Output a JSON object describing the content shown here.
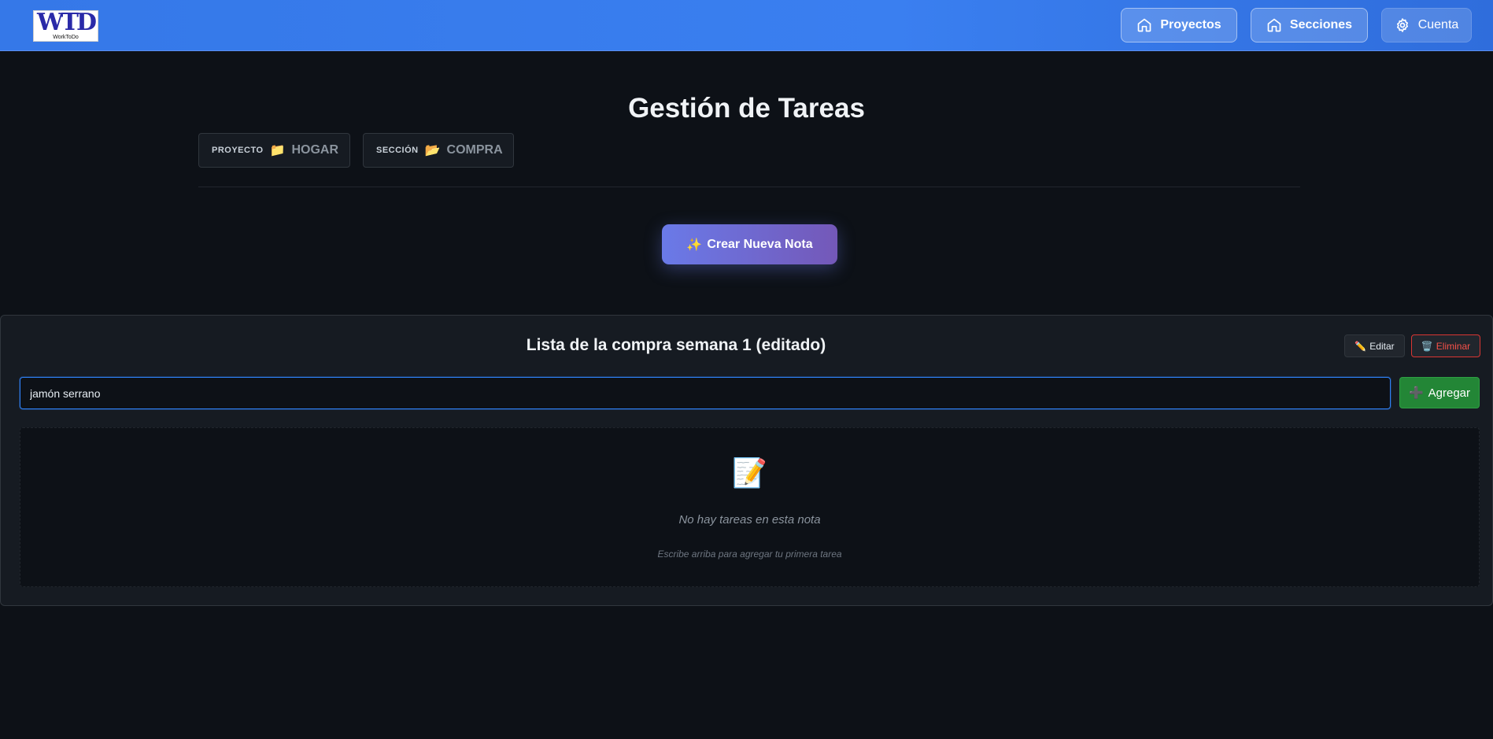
{
  "header": {
    "logo": {
      "mark": "WTD",
      "subtitle": "WorkToDo"
    },
    "nav": [
      {
        "label": "Proyectos",
        "icon": "home-icon"
      },
      {
        "label": "Secciones",
        "icon": "home-icon"
      },
      {
        "label": "Cuenta",
        "icon": "gear-icon"
      }
    ],
    "colors": {
      "bar": "#3578e8"
    }
  },
  "page": {
    "title": "Gestión de Tareas",
    "breadcrumbs": [
      {
        "label": "PROYECTO",
        "icon": "📁",
        "value": "HOGAR"
      },
      {
        "label": "SECCIÓN",
        "icon": "📂",
        "value": "COMPRA"
      }
    ],
    "create_button": {
      "icon": "✨",
      "label": "Crear Nueva Nota"
    }
  },
  "note": {
    "title": "Lista de la compra semana 1 (editado)",
    "edit": {
      "icon": "✏️",
      "label": "Editar"
    },
    "delete": {
      "icon": "🗑️",
      "label": "Eliminar"
    },
    "input": {
      "value": "jamón serrano",
      "placeholder": ""
    },
    "add": {
      "icon": "➕",
      "label": "Agregar"
    },
    "empty": {
      "icon": "📝",
      "message": "No hay tareas en esta nota",
      "hint": "Escribe arriba para agregar tu primera tarea"
    }
  }
}
